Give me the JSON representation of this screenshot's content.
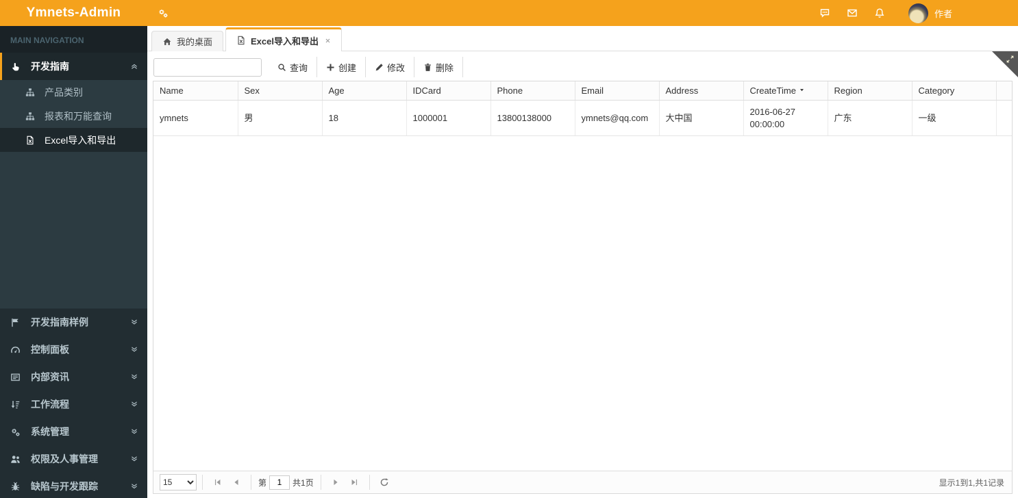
{
  "header": {
    "brand": "Ymnets-Admin",
    "toggle_icon": "cogs",
    "actions": [
      {
        "name": "messages",
        "icon": "comment"
      },
      {
        "name": "mail",
        "icon": "envelope"
      },
      {
        "name": "notifications",
        "icon": "bell"
      }
    ],
    "user": {
      "name": "作者"
    }
  },
  "sidebar": {
    "section_label": "MAIN NAVIGATION",
    "menu": [
      {
        "label": "开发指南",
        "icon": "hand-pointer",
        "active": true,
        "expanded": true,
        "children": [
          {
            "label": "产品类别",
            "icon": "sitemap"
          },
          {
            "label": "报表和万能查询",
            "icon": "sitemap"
          },
          {
            "label": "Excel导入和导出",
            "icon": "file-excel",
            "active": true
          }
        ]
      },
      {
        "label": "开发指南样例",
        "icon": "flag"
      },
      {
        "label": "控制面板",
        "icon": "gauge"
      },
      {
        "label": "内部资讯",
        "icon": "newspaper"
      },
      {
        "label": "工作流程",
        "icon": "workflow"
      },
      {
        "label": "系统管理",
        "icon": "cogs"
      },
      {
        "label": "权限及人事管理",
        "icon": "users"
      },
      {
        "label": "缺陷与开发跟踪",
        "icon": "bug"
      }
    ]
  },
  "tabs": [
    {
      "label": "我的桌面",
      "icon": "home",
      "active": false,
      "closable": false
    },
    {
      "label": "Excel导入和导出",
      "icon": "file-excel",
      "active": true,
      "closable": true
    }
  ],
  "panel": {
    "corner_icon": "expand"
  },
  "toolbar": {
    "search": {
      "value": "",
      "placeholder": ""
    },
    "buttons": [
      {
        "label": "查询",
        "icon": "search"
      },
      {
        "label": "创建",
        "icon": "plus"
      },
      {
        "label": "修改",
        "icon": "pencil"
      },
      {
        "label": "删除",
        "icon": "trash"
      }
    ]
  },
  "grid": {
    "columns": [
      {
        "label": "Name"
      },
      {
        "label": "Sex"
      },
      {
        "label": "Age"
      },
      {
        "label": "IDCard"
      },
      {
        "label": "Phone"
      },
      {
        "label": "Email"
      },
      {
        "label": "Address"
      },
      {
        "label": "CreateTime",
        "sorted": "desc"
      },
      {
        "label": "Region"
      },
      {
        "label": "Category"
      }
    ],
    "rows": [
      [
        "ymnets",
        "男",
        "18",
        "1000001",
        "13800138000",
        "ymnets@qq.com",
        "大中国",
        "2016-06-27 00:00:00",
        "广东",
        "一级"
      ]
    ]
  },
  "pager": {
    "page_size": "15",
    "page_prefix": "第",
    "page_value": "1",
    "total_pages_label": "共1页",
    "info": "显示1到1,共1记录",
    "buttons": {
      "first": "page-first",
      "prev": "page-prev",
      "next": "page-next",
      "last": "page-last",
      "refresh": "refresh"
    }
  }
}
